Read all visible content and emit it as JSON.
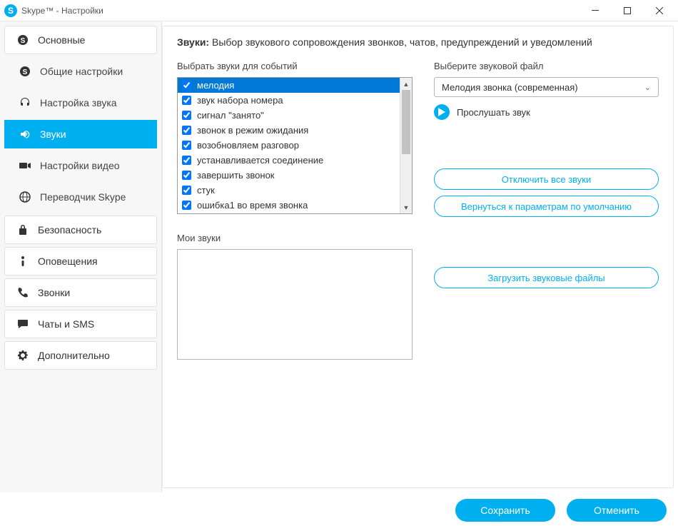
{
  "window": {
    "title": "Skype™ - Настройки"
  },
  "sidebar": {
    "sections": [
      {
        "label": "Основные",
        "icon": "skype"
      },
      {
        "label": "Безопасность",
        "icon": "lock"
      },
      {
        "label": "Оповещения",
        "icon": "info"
      },
      {
        "label": "Звонки",
        "icon": "phone"
      },
      {
        "label": "Чаты и SMS",
        "icon": "chat"
      },
      {
        "label": "Дополнительно",
        "icon": "gear"
      }
    ],
    "subs": [
      {
        "label": "Общие настройки",
        "icon": "skype"
      },
      {
        "label": "Настройка звука",
        "icon": "headset"
      },
      {
        "label": "Звуки",
        "icon": "speaker",
        "active": true
      },
      {
        "label": "Настройки видео",
        "icon": "camera"
      },
      {
        "label": "Переводчик Skype",
        "icon": "globe"
      }
    ]
  },
  "main": {
    "heading_bold": "Звуки:",
    "heading_rest": " Выбор звукового сопровождения звонков, чатов, предупреждений и уведомлений",
    "events_label": "Выбрать звуки для событий",
    "file_label": "Выберите звуковой файл",
    "selected_file": "Мелодия звонка (современная)",
    "play_label": "Прослушать звук",
    "disable_all": "Отключить все звуки",
    "reset_defaults": "Вернуться к параметрам по умолчанию",
    "my_sounds_label": "Мои звуки",
    "upload_label": "Загрузить звуковые файлы",
    "events": [
      {
        "label": "мелодия",
        "checked": true,
        "selected": true
      },
      {
        "label": "звук набора номера",
        "checked": true
      },
      {
        "label": "сигнал \"занято\"",
        "checked": true
      },
      {
        "label": "звонок в режим ожидания",
        "checked": true
      },
      {
        "label": "возобновляем разговор",
        "checked": true
      },
      {
        "label": "устанавливается соединение",
        "checked": true
      },
      {
        "label": "завершить звонок",
        "checked": true
      },
      {
        "label": "стук",
        "checked": true
      },
      {
        "label": "ошибка1 во время звонка",
        "checked": true
      }
    ]
  },
  "footer": {
    "save": "Сохранить",
    "cancel": "Отменить"
  }
}
